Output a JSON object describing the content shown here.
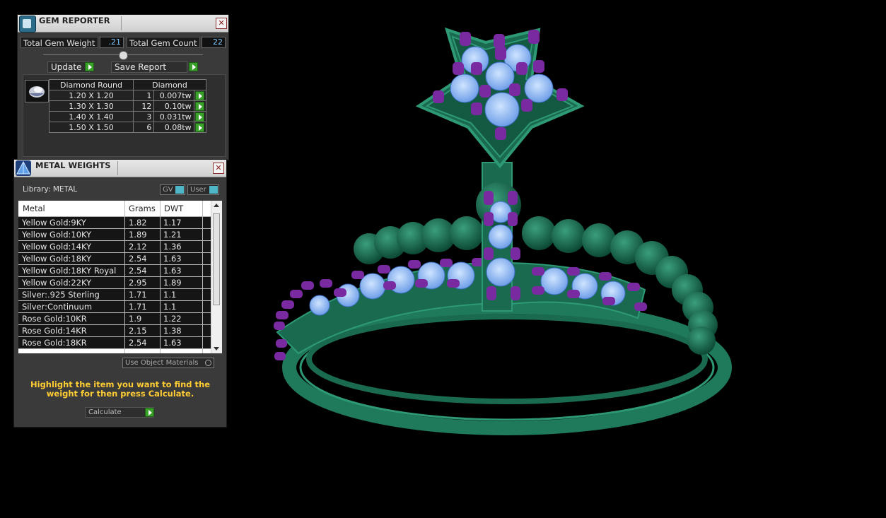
{
  "gem_reporter": {
    "title": "GEM REPORTER",
    "close": "✕",
    "total_weight_label": "Total Gem Weight",
    "total_weight_value": ".21",
    "total_count_label": "Total Gem Count",
    "total_count_value": "22",
    "update_label": "Update",
    "save_report_label": "Save Report",
    "table": {
      "headers": [
        "Diamond Round",
        "Diamond"
      ],
      "rows": [
        {
          "size": "1.20 X 1.20",
          "count": "1",
          "weight": "0.007tw"
        },
        {
          "size": "1.30 X 1.30",
          "count": "12",
          "weight": "0.10tw"
        },
        {
          "size": "1.40 X 1.40",
          "count": "3",
          "weight": "0.031tw"
        },
        {
          "size": "1.50 X 1.50",
          "count": "6",
          "weight": "0.08tw"
        }
      ]
    }
  },
  "metal_weights": {
    "title": "METAL WEIGHTS",
    "close": "✕",
    "library_label": "Library: METAL",
    "gv_label": "GV",
    "user_label": "User",
    "columns": [
      "Metal",
      "Grams",
      "DWT"
    ],
    "rows": [
      {
        "metal": "Yellow Gold:9KY",
        "grams": "1.82",
        "dwt": "1.17"
      },
      {
        "metal": "Yellow Gold:10KY",
        "grams": "1.89",
        "dwt": "1.21"
      },
      {
        "metal": "Yellow Gold:14KY",
        "grams": "2.12",
        "dwt": "1.36"
      },
      {
        "metal": "Yellow Gold:18KY",
        "grams": "2.54",
        "dwt": "1.63"
      },
      {
        "metal": "Yellow Gold:18KY Royal",
        "grams": "2.54",
        "dwt": "1.63"
      },
      {
        "metal": "Yellow Gold:22KY",
        "grams": "2.95",
        "dwt": "1.89"
      },
      {
        "metal": "Silver:.925 Sterling",
        "grams": "1.71",
        "dwt": "1.1"
      },
      {
        "metal": "Silver:Continuum",
        "grams": "1.71",
        "dwt": "1.1"
      },
      {
        "metal": "Rose Gold:10KR",
        "grams": "1.9",
        "dwt": "1.22"
      },
      {
        "metal": "Rose Gold:14KR",
        "grams": "2.15",
        "dwt": "1.38"
      },
      {
        "metal": "Rose Gold:18KR",
        "grams": "2.54",
        "dwt": "1.63"
      }
    ],
    "use_object_materials_label": "Use Object Materials",
    "hint": "Highlight the item you want to find the weight for then press Calculate.",
    "calculate_label": "Calculate"
  },
  "colors": {
    "metal_green": "#1f7a5c",
    "gem_blue": "#8fbff5",
    "prong_purple": "#7a2aa0",
    "hint_yellow": "#ffcc33"
  }
}
